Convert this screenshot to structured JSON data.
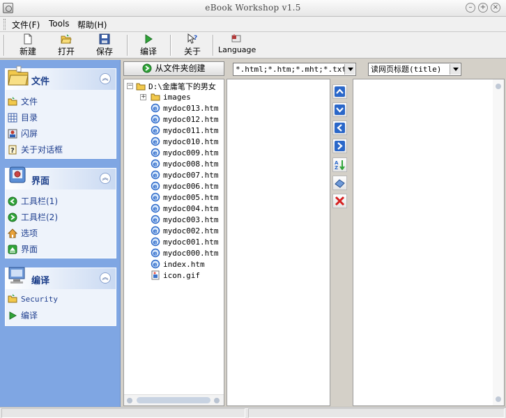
{
  "window": {
    "title": "eBook Workshop v1.5"
  },
  "menu": {
    "file": "文件(F)",
    "tools": "Tools",
    "help": "帮助(H)"
  },
  "toolbar": {
    "new": "新建",
    "open": "打开",
    "save": "保存",
    "compile": "编译",
    "about": "关于",
    "language": "Language"
  },
  "sidebar": {
    "file_panel": {
      "title": "文件",
      "items": [
        "文件",
        "目录",
        "闪屏",
        "关于对话框"
      ]
    },
    "ui_panel": {
      "title": "界面",
      "items": [
        "工具栏(1)",
        "工具栏(2)",
        "选项",
        "界面"
      ]
    },
    "compile_panel": {
      "title": "编译",
      "items": [
        "Security",
        "编译"
      ]
    }
  },
  "main": {
    "create_from_folder": "从文件夹创建",
    "filter": "*.html;*.htm;*.mht;*.txt",
    "title_mode": "读网页标题(title)",
    "tree_root": "D:\\金庸笔下的男女",
    "tree_items": [
      "images",
      "mydoc013.htm",
      "mydoc012.htm",
      "mydoc011.htm",
      "mydoc010.htm",
      "mydoc009.htm",
      "mydoc008.htm",
      "mydoc007.htm",
      "mydoc006.htm",
      "mydoc005.htm",
      "mydoc004.htm",
      "mydoc003.htm",
      "mydoc002.htm",
      "mydoc001.htm",
      "mydoc000.htm",
      "index.htm",
      "icon.gif"
    ]
  },
  "icons": {
    "move_buttons": [
      "move-up-icon",
      "move-down-icon",
      "move-left-icon",
      "move-right-icon",
      "sort-icon",
      "clear-icon",
      "delete-icon"
    ]
  },
  "colors": {
    "sidebar_bg": "#7fa6e3",
    "panel_title": "#1d3f8a",
    "item_text": "#1f3f8f",
    "arrow_blue": "#2a67c9",
    "delete_red": "#d62020"
  }
}
